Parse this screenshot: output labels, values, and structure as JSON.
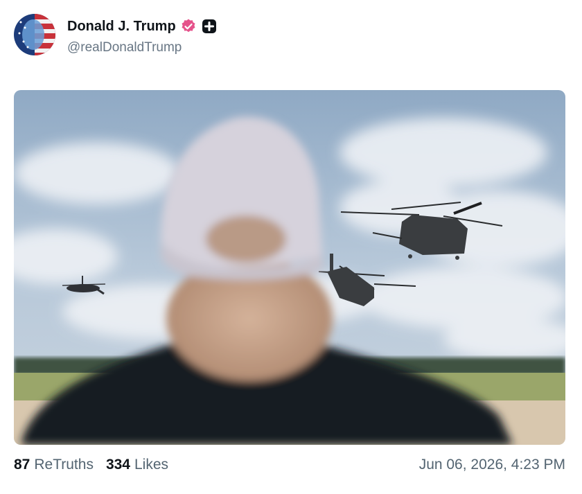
{
  "post": {
    "author": {
      "display_name": "Donald J. Trump",
      "handle": "@realDonaldTrump",
      "verified_badge_icon": "verified-badge-icon",
      "plus_badge_icon": "plus-square-icon",
      "badge_color": "#e5528b"
    },
    "media": {
      "type": "photo"
    },
    "stats": {
      "retruths_count": "87",
      "retruths_label": "ReTruths",
      "likes_count": "334",
      "likes_label": "Likes"
    },
    "timestamp": "Jun 06, 2026, 4:23 PM"
  }
}
